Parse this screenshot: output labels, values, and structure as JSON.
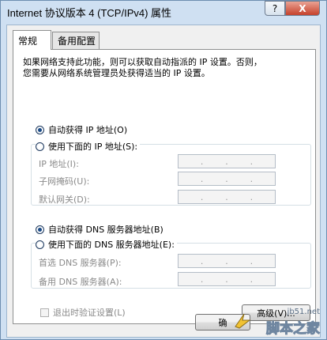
{
  "window": {
    "title": "Internet 协议版本 4 (TCP/IPv4) 属性",
    "help_label": "?",
    "close_label": "X"
  },
  "tabs": [
    {
      "label": "常规",
      "active": true
    },
    {
      "label": "备用配置",
      "active": false
    }
  ],
  "description": {
    "line1": "如果网络支持此功能，则可以获取自动指派的 IP 设置。否则，",
    "line2": "您需要从网络系统管理员处获得适当的 IP 设置。"
  },
  "ip_section": {
    "auto_label": "自动获得 IP 地址(O)",
    "auto_selected": true,
    "manual_label": "使用下面的 IP 地址(S):",
    "fields": [
      {
        "label": "IP 地址(I):",
        "value": ". . ."
      },
      {
        "label": "子网掩码(U):",
        "value": ". . ."
      },
      {
        "label": "默认网关(D):",
        "value": ". . ."
      }
    ]
  },
  "dns_section": {
    "auto_label": "自动获得 DNS 服务器地址(B)",
    "auto_selected": true,
    "manual_label": "使用下面的 DNS 服务器地址(E):",
    "fields": [
      {
        "label": "首选 DNS 服务器(P):",
        "value": ". . ."
      },
      {
        "label": "备用 DNS 服务器(A):",
        "value": ". . ."
      }
    ]
  },
  "validate_on_exit": {
    "label": "退出时验证设置(L)",
    "checked": false
  },
  "advanced_button": "高级(V)...",
  "ok_button": "确",
  "watermark": {
    "url": "jb51.net",
    "name": "脚本之家"
  },
  "colors": {
    "title_bg": "#cfe0f2",
    "close_red": "#c6412b",
    "radio_dot": "#1b4a86"
  }
}
